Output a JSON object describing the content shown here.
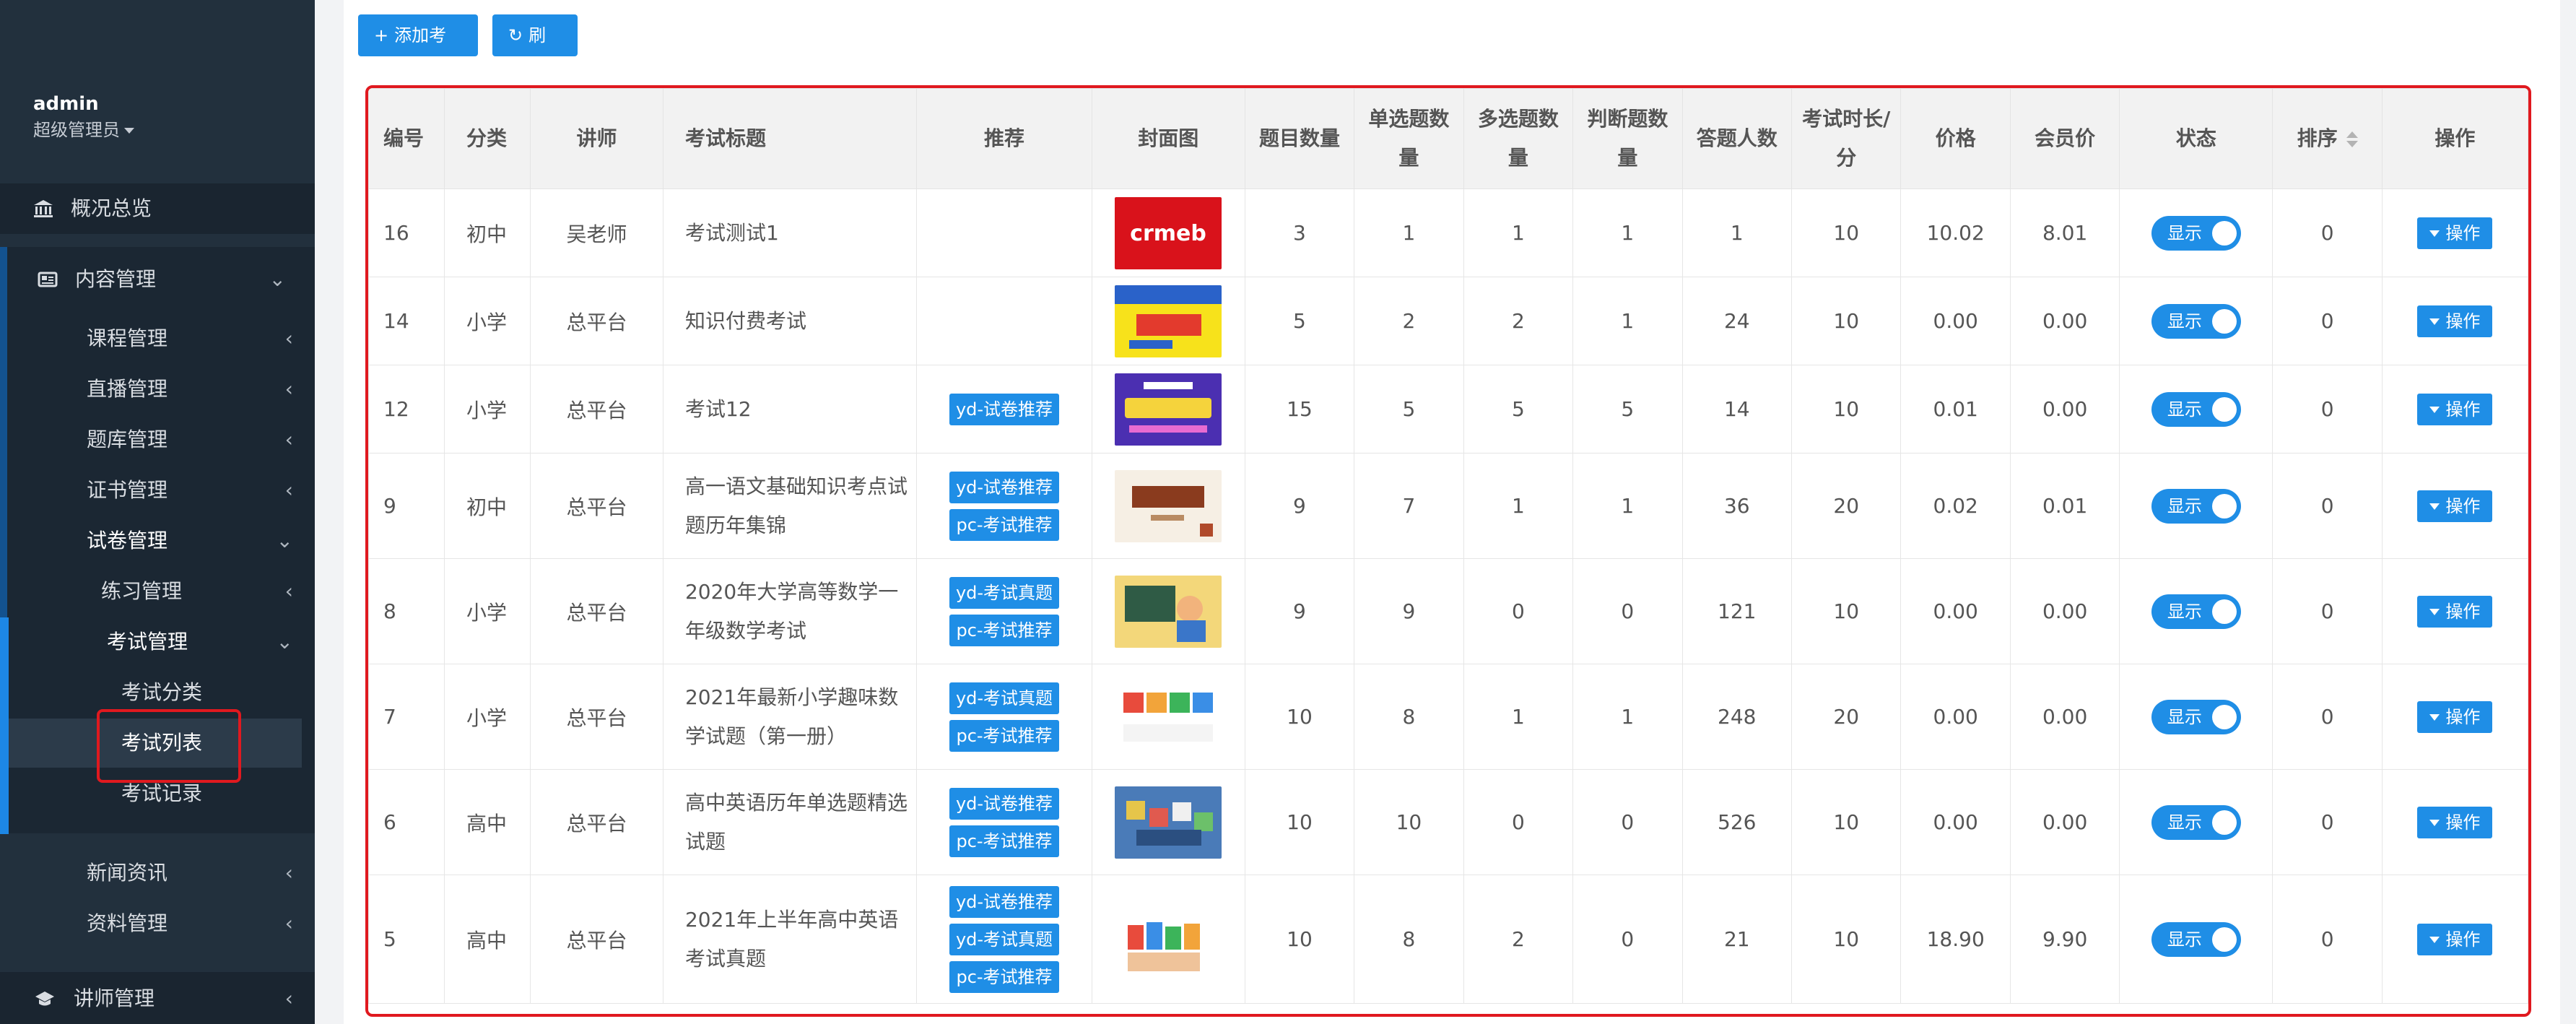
{
  "user": {
    "name": "admin",
    "role": "超级管理员"
  },
  "nav": {
    "overview": "概况总览",
    "content": "内容管理",
    "course": "课程管理",
    "live": "直播管理",
    "question_bank": "题库管理",
    "certificate": "证书管理",
    "paper": "试卷管理",
    "practice": "练习管理",
    "exam": "考试管理",
    "exam_category": "考试分类",
    "exam_list": "考试列表",
    "exam_record": "考试记录",
    "news": "新闻资讯",
    "material": "资料管理",
    "teacher": "讲师管理"
  },
  "toolbar": {
    "add_label": "添加考试",
    "refresh_label": "刷新"
  },
  "table": {
    "headers": [
      "编号",
      "分类",
      "讲师",
      "考试标题",
      "推荐",
      "封面图",
      "题目数量",
      "单选题数量",
      "多选题数量",
      "判断题数量",
      "答题人数",
      "考试时长/分",
      "价格",
      "会员价",
      "状态",
      "排序",
      "操作"
    ],
    "rows": [
      {
        "id": "16",
        "category": "初中",
        "teacher": "吴老师",
        "title": "考试测试1",
        "tags": [],
        "cover": "crmeb-logo",
        "questions": "3",
        "single": "1",
        "multi": "1",
        "judge": "1",
        "participants": "1",
        "duration": "10",
        "price": "10.02",
        "member_price": "8.01",
        "status": "显示",
        "sort": "0",
        "op": "操作"
      },
      {
        "id": "14",
        "category": "小学",
        "teacher": "总平台",
        "title": "知识付费考试",
        "tags": [],
        "cover": "word-puzzle-cover",
        "questions": "5",
        "single": "2",
        "multi": "2",
        "judge": "1",
        "participants": "24",
        "duration": "10",
        "price": "0.00",
        "member_price": "0.00",
        "status": "显示",
        "sort": "0",
        "op": "操作"
      },
      {
        "id": "12",
        "category": "小学",
        "teacher": "总平台",
        "title": "考试12",
        "tags": [
          "yd-试卷推荐"
        ],
        "cover": "exam-system-cover",
        "questions": "15",
        "single": "5",
        "multi": "5",
        "judge": "5",
        "participants": "14",
        "duration": "10",
        "price": "0.01",
        "member_price": "0.00",
        "status": "显示",
        "sort": "0",
        "op": "操作"
      },
      {
        "id": "9",
        "category": "初中",
        "teacher": "总平台",
        "title": "高一语文基础知识考点试题历年集锦",
        "tags": [
          "yd-试卷推荐",
          "pc-考试推荐"
        ],
        "cover": "chinese-cover",
        "questions": "9",
        "single": "7",
        "multi": "1",
        "judge": "1",
        "participants": "36",
        "duration": "20",
        "price": "0.02",
        "member_price": "0.01",
        "status": "显示",
        "sort": "0",
        "op": "操作"
      },
      {
        "id": "8",
        "category": "小学",
        "teacher": "总平台",
        "title": "2020年大学高等数学一年级数学考试",
        "tags": [
          "yd-考试真题",
          "pc-考试推荐"
        ],
        "cover": "student-cover",
        "questions": "9",
        "single": "9",
        "multi": "0",
        "judge": "0",
        "participants": "121",
        "duration": "10",
        "price": "0.00",
        "member_price": "0.00",
        "status": "显示",
        "sort": "0",
        "op": "操作"
      },
      {
        "id": "7",
        "category": "小学",
        "teacher": "总平台",
        "title": "2021年最新小学趣味数学试题（第一册）",
        "tags": [
          "yd-考试真题",
          "pc-考试推荐"
        ],
        "cover": "math-cover",
        "questions": "10",
        "single": "8",
        "multi": "1",
        "judge": "1",
        "participants": "248",
        "duration": "20",
        "price": "0.00",
        "member_price": "0.00",
        "status": "显示",
        "sort": "0",
        "op": "操作"
      },
      {
        "id": "6",
        "category": "高中",
        "teacher": "总平台",
        "title": "高中英语历年单选题精选试题",
        "tags": [
          "yd-试卷推荐",
          "pc-考试推荐"
        ],
        "cover": "english-blocks-cover",
        "questions": "10",
        "single": "10",
        "multi": "0",
        "judge": "0",
        "participants": "526",
        "duration": "10",
        "price": "0.00",
        "member_price": "0.00",
        "status": "显示",
        "sort": "0",
        "op": "操作"
      },
      {
        "id": "5",
        "category": "高中",
        "teacher": "总平台",
        "title": "2021年上半年高中英语考试真题",
        "tags": [
          "yd-试卷推荐",
          "yd-考试真题",
          "pc-考试推荐"
        ],
        "cover": "english-hands-cover",
        "questions": "10",
        "single": "8",
        "multi": "2",
        "judge": "0",
        "participants": "21",
        "duration": "10",
        "price": "18.90",
        "member_price": "9.90",
        "status": "显示",
        "sort": "0",
        "op": "操作"
      }
    ]
  },
  "covers": {
    "crmeb-logo": "crmeb"
  },
  "colors": {
    "accent": "#1f8ee6",
    "sidebar": "#22303d",
    "highlight": "#e0191f"
  }
}
